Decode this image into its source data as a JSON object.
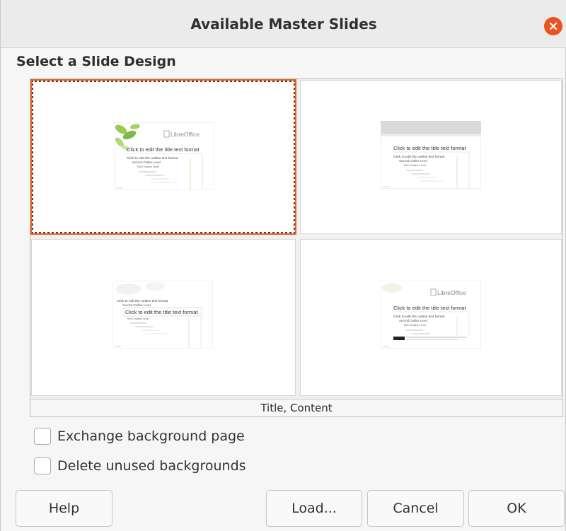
{
  "window": {
    "title": "Available Master Slides"
  },
  "section": {
    "label": "Select a Slide Design"
  },
  "thumbnail_text": {
    "title": "Click to edit the title text format",
    "outline": "Click to edit the outline text format",
    "second": "Second Outline Level",
    "third": "Third Outline Level",
    "brand": "LibreOffice"
  },
  "gallery": {
    "selected_label": "Title, Content"
  },
  "options": {
    "exchange": {
      "label": "Exchange background page",
      "checked": false
    },
    "delete": {
      "label": "Delete unused backgrounds",
      "checked": false
    }
  },
  "buttons": {
    "help": "Help",
    "load": "Load...",
    "cancel": "Cancel",
    "ok": "OK"
  },
  "colors": {
    "accent": "#e95420",
    "selection": "#7a2d10",
    "brand_green": "#8cc63f"
  }
}
